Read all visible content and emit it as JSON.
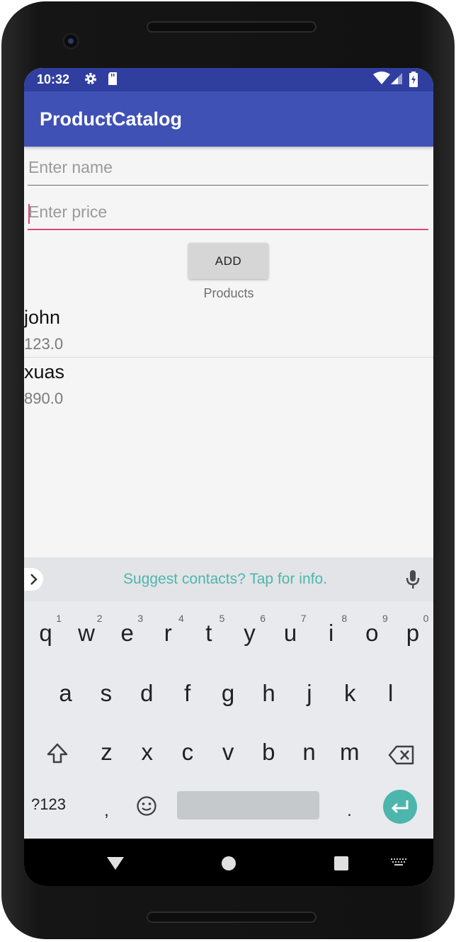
{
  "status_bar": {
    "time": "10:32",
    "icons": [
      "gear-icon",
      "sd-card-icon",
      "wifi-icon",
      "signal-icon",
      "battery-icon"
    ]
  },
  "app": {
    "title": "ProductCatalog",
    "colors": {
      "primary": "#3f51b5",
      "primary_dark": "#303f9f",
      "accent": "#e0457b"
    }
  },
  "form": {
    "name_placeholder": "Enter name",
    "name_value": "",
    "price_placeholder": "Enter price",
    "price_value": "",
    "add_label": "ADD"
  },
  "products": {
    "label": "Products",
    "items": [
      {
        "name": "john",
        "price": "123.0"
      },
      {
        "name": "xuas",
        "price": "890.0"
      }
    ]
  },
  "keyboard": {
    "suggestion": "Suggest contacts? Tap for info.",
    "row1": [
      {
        "key": "q",
        "hint": "1"
      },
      {
        "key": "w",
        "hint": "2"
      },
      {
        "key": "e",
        "hint": "3"
      },
      {
        "key": "r",
        "hint": "4"
      },
      {
        "key": "t",
        "hint": "5"
      },
      {
        "key": "y",
        "hint": "6"
      },
      {
        "key": "u",
        "hint": "7"
      },
      {
        "key": "i",
        "hint": "8"
      },
      {
        "key": "o",
        "hint": "9"
      },
      {
        "key": "p",
        "hint": "0"
      }
    ],
    "row2": [
      "a",
      "s",
      "d",
      "f",
      "g",
      "h",
      "j",
      "k",
      "l"
    ],
    "row3": [
      "z",
      "x",
      "c",
      "v",
      "b",
      "n",
      "m"
    ],
    "symbols_label": "?123",
    "comma": ",",
    "period": ".",
    "accent_color": "#4db6ac"
  }
}
